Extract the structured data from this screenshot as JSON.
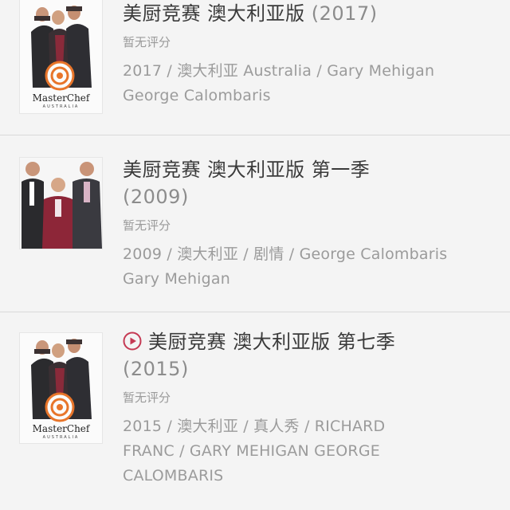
{
  "items": [
    {
      "title": "美厨竞赛 澳大利亚版",
      "year": "(2017)",
      "rating": "暂无评分",
      "meta": [
        "2017 / 澳大利亚 Australia / Gary Mehigan",
        "George Calombaris"
      ],
      "poster": {
        "logo_text": "MasterChef",
        "logo_sub": "AUSTRALIA"
      },
      "playable": false
    },
    {
      "title": "美厨竞赛 澳大利亚版 第一季",
      "year": "(2009)",
      "rating": "暂无评分",
      "meta": [
        "2009 / 澳大利亚 / 剧情 / George Calombaris",
        "Gary Mehigan"
      ],
      "playable": false
    },
    {
      "title": "美厨竞赛 澳大利亚版 第七季",
      "year": "(2015)",
      "rating": "暂无评分",
      "meta": [
        "2015 / 澳大利亚 / 真人秀 / RICHARD",
        "FRANC / GARY MEHIGAN GEORGE",
        "CALOMBARIS"
      ],
      "poster": {
        "logo_text": "MasterChef",
        "logo_sub": "AUSTRALIA"
      },
      "playable": true
    }
  ],
  "colors": {
    "background": "#f4f4f4",
    "title": "#3a3a3a",
    "secondary": "#9b9b9b",
    "play_accent": "#c53a54",
    "logo_orange": "#e8752a"
  },
  "icons": [
    "play-icon"
  ]
}
